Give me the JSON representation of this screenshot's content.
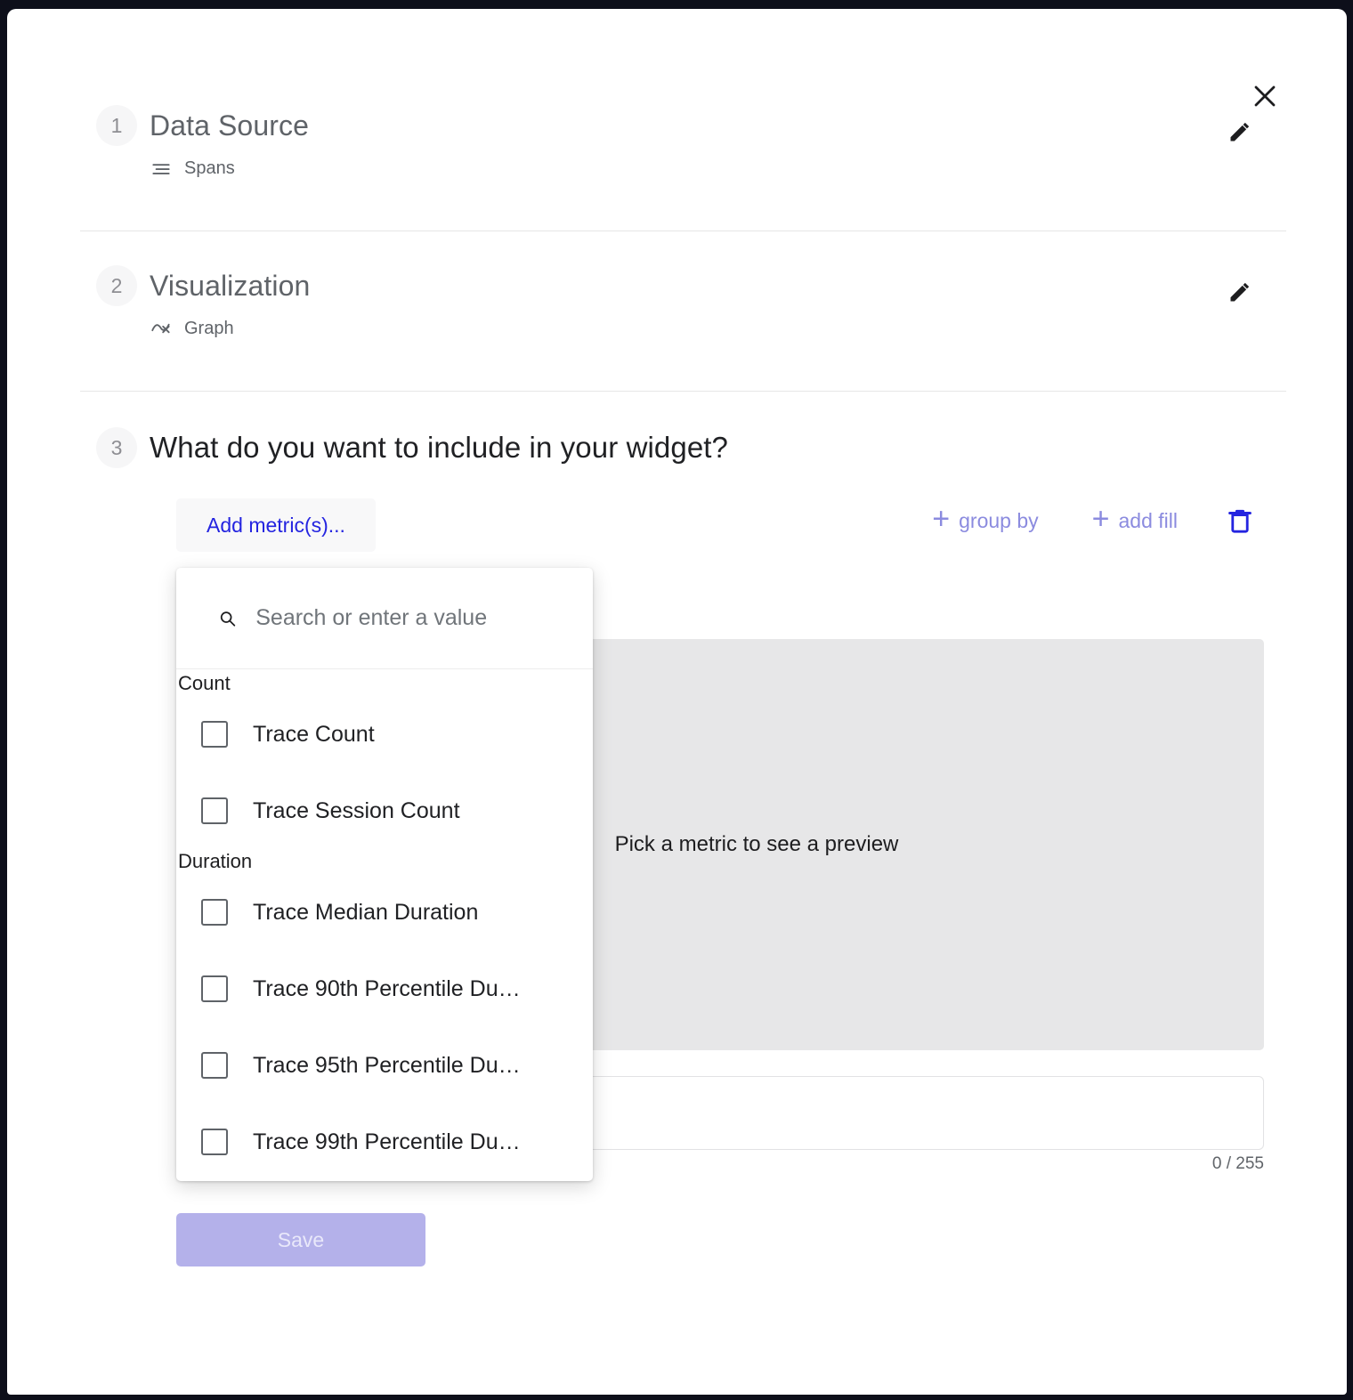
{
  "steps": [
    {
      "number": "1",
      "title": "Data Source",
      "sub_label": "Spans",
      "sub_icon": "spans-icon",
      "edit_icon": "pencil-icon"
    },
    {
      "number": "2",
      "title": "Visualization",
      "sub_label": "Graph",
      "sub_icon": "graph-icon",
      "edit_icon": "pencil-icon"
    },
    {
      "number": "3",
      "title": "What do you want to include in your widget?"
    }
  ],
  "header": {
    "close_icon": "close-icon"
  },
  "toolbar": {
    "add_metric_label": "Add metric(s)...",
    "group_by_label": "group by",
    "add_fill_label": "add fill",
    "delete_icon": "trash-icon",
    "plus_glyph": "+"
  },
  "preview": {
    "placeholder_text": "Pick a metric to see a preview"
  },
  "description": {
    "value": "",
    "placeholder": "",
    "char_count": "0 / 255"
  },
  "footer": {
    "save_label": "Save"
  },
  "dropdown": {
    "search": {
      "placeholder": "Search or enter a value",
      "value": "",
      "icon": "search-icon"
    },
    "groups": [
      {
        "label": "Count",
        "items": [
          {
            "label": "Trace Count",
            "checked": false
          },
          {
            "label": "Trace Session Count",
            "checked": false
          }
        ]
      },
      {
        "label": "Duration",
        "items": [
          {
            "label": "Trace Median Duration",
            "checked": false
          },
          {
            "label": "Trace 90th Percentile Du…",
            "checked": false
          },
          {
            "label": "Trace 95th Percentile Du…",
            "checked": false
          },
          {
            "label": "Trace 99th Percentile Du…",
            "checked": false
          }
        ]
      }
    ]
  },
  "colors": {
    "accent_blue": "#2424e0",
    "muted_purple": "#8b8bdf",
    "save_disabled": "#b4b1ea",
    "preview_gray": "#e7e7e8",
    "frame_dark": "#0d0f1a"
  }
}
